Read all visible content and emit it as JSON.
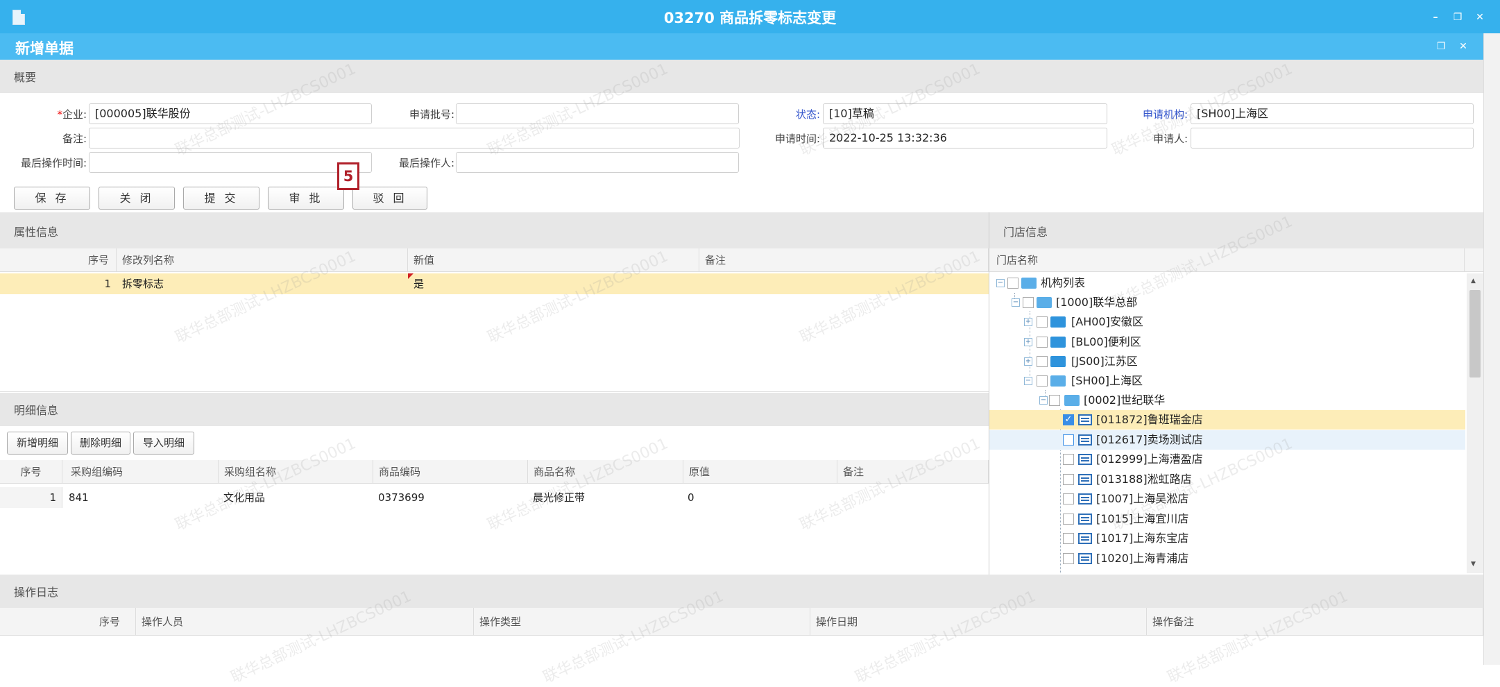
{
  "window": {
    "title": "03270 商品拆零标志变更",
    "min": "–",
    "restore": "❐",
    "close": "✕"
  },
  "form": {
    "title": "新增单据"
  },
  "summary": {
    "section": "概要",
    "fields": {
      "company_label": "企业:",
      "company_value": "[000005]联华股份",
      "batch_label": "申请批号:",
      "batch_value": "",
      "status_label": "状态:",
      "status_value": "[10]草稿",
      "org_label": "申请机构:",
      "org_value": "[SH00]上海区",
      "remark_label": "备注:",
      "remark_value": "",
      "apply_time_label": "申请时间:",
      "apply_time_value": "2022-10-25 13:32:36",
      "applicant_label": "申请人:",
      "applicant_value": "",
      "last_time_label": "最后操作时间:",
      "last_time_value": "",
      "last_user_label": "最后操作人:",
      "last_user_value": ""
    },
    "buttons": {
      "save": "保 存",
      "close": "关 闭",
      "submit": "提 交",
      "approve": "审 批",
      "reject": "驳 回"
    },
    "step_badge": "5"
  },
  "attributes": {
    "section": "属性信息",
    "columns": [
      "序号",
      "修改列名称",
      "新值",
      "备注"
    ],
    "rows": [
      {
        "no": "1",
        "name": "拆零标志",
        "value": "是",
        "remark": ""
      }
    ]
  },
  "details": {
    "section": "明细信息",
    "buttons": {
      "add": "新增明细",
      "delete": "删除明细",
      "import": "导入明细"
    },
    "columns": [
      "序号",
      "采购组编码",
      "采购组名称",
      "商品编码",
      "商品名称",
      "原值",
      "备注"
    ],
    "rows": [
      {
        "no": "1",
        "code": "841",
        "group": "文化用品",
        "item": "0373699",
        "name": "晨光修正带",
        "orig": "0",
        "remark": ""
      }
    ]
  },
  "stores": {
    "section": "门店信息",
    "column": "门店名称",
    "tree": {
      "root": "机构列表",
      "hq": "[1000]联华总部",
      "ah": "[AH00]安徽区",
      "bl": "[BL00]便利区",
      "js": "[JS00]江苏区",
      "sh": "[SH00]上海区",
      "sj": "[0002]世纪联华",
      "leaves": [
        "[011872]鲁班瑞金店",
        "[012617]卖场测试店",
        "[012999]上海漕盈店",
        "[013188]淞虹路店",
        "[1007]上海吴淞店",
        "[1015]上海宜川店",
        "[1017]上海东宝店",
        "[1020]上海青浦店"
      ]
    }
  },
  "log": {
    "section": "操作日志",
    "columns": [
      "序号",
      "操作人员",
      "操作类型",
      "操作日期",
      "操作备注"
    ]
  },
  "watermark": "联华总部测试-LHZBCS0001"
}
